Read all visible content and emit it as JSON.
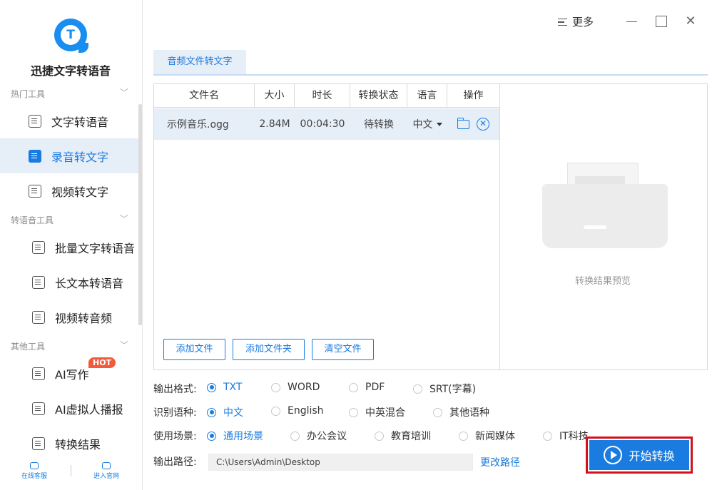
{
  "app": {
    "name": "迅捷文字转语音"
  },
  "window": {
    "more_label": "更多"
  },
  "sidebar": {
    "groups": [
      {
        "title": "热门工具"
      },
      {
        "title": "转语音工具"
      },
      {
        "title": "其他工具"
      }
    ],
    "items": [
      {
        "label": "文字转语音"
      },
      {
        "label": "录音转文字",
        "active": true
      },
      {
        "label": "视频转文字"
      },
      {
        "label": "批量文字转语音"
      },
      {
        "label": "长文本转语音"
      },
      {
        "label": "视频转音频"
      },
      {
        "label": "AI写作",
        "badge": "HOT"
      },
      {
        "label": "AI虚拟人播报"
      },
      {
        "label": "转换结果"
      }
    ],
    "footer": {
      "service": "在线客服",
      "website": "进入官网"
    }
  },
  "tab": {
    "label": "音频文件转文字"
  },
  "table": {
    "headers": [
      "文件名",
      "大小",
      "时长",
      "转换状态",
      "语言",
      "操作"
    ],
    "rows": [
      {
        "name": "示例音乐.ogg",
        "size": "2.84M",
        "duration": "00:04:30",
        "status": "待转换",
        "language": "中文"
      }
    ]
  },
  "buttons": {
    "add_file": "添加文件",
    "add_folder": "添加文件夹",
    "clear_files": "清空文件",
    "start": "开始转换"
  },
  "preview": {
    "label": "转换结果预览"
  },
  "options": {
    "format": {
      "label": "输出格式:",
      "choices": [
        "TXT",
        "WORD",
        "PDF",
        "SRT(字幕)"
      ],
      "selected": "TXT"
    },
    "language": {
      "label": "识别语种:",
      "choices": [
        "中文",
        "English",
        "中英混合",
        "其他语种"
      ],
      "selected": "中文"
    },
    "scene": {
      "label": "使用场景:",
      "choices": [
        "通用场景",
        "办公会议",
        "教育培训",
        "新闻媒体",
        "IT科技"
      ],
      "selected": "通用场景"
    }
  },
  "output": {
    "label": "输出路径:",
    "path": "C:\\Users\\Admin\\Desktop",
    "change_label": "更改路径"
  },
  "colors": {
    "accent": "#1a7ce0",
    "highlight": "#e6eef8",
    "hot_badge": "#f25a3a",
    "focus_frame": "#d4111b"
  }
}
